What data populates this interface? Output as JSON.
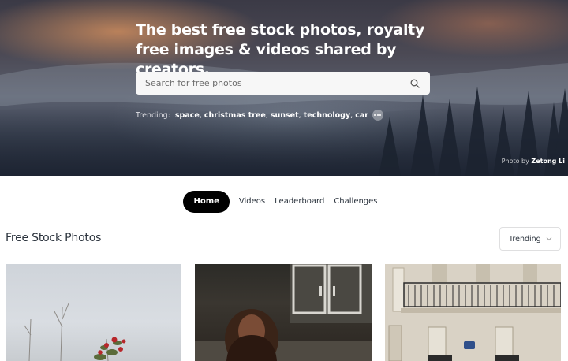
{
  "hero": {
    "title": "The best free stock photos, royalty free images & videos shared by creators.",
    "search": {
      "placeholder": "Search for free photos",
      "value": ""
    },
    "trending_label": "Trending:",
    "trending_terms": [
      "space",
      "christmas tree",
      "sunset",
      "technology",
      "car"
    ],
    "credit_prefix": "Photo by",
    "credit_name": "Zetong Li"
  },
  "nav": {
    "tabs": [
      {
        "label": "Home",
        "active": true
      },
      {
        "label": "Videos",
        "active": false
      },
      {
        "label": "Leaderboard",
        "active": false
      },
      {
        "label": "Challenges",
        "active": false
      }
    ]
  },
  "section": {
    "title": "Free Stock Photos",
    "sort_value": "Trending"
  },
  "icons": {
    "search": "search-icon",
    "more": "more-icon",
    "chevron": "chevron-down-icon"
  },
  "colors": {
    "active_tab_bg": "#000000",
    "text_dark": "#2c343e"
  }
}
